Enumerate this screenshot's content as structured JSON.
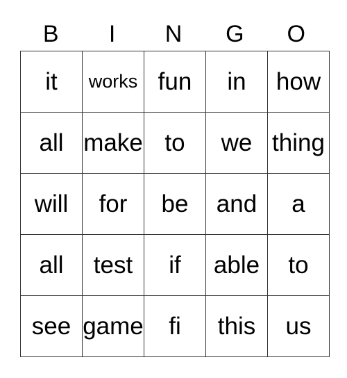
{
  "header": [
    "B",
    "I",
    "N",
    "G",
    "O"
  ],
  "rows": [
    [
      "it",
      "works",
      "fun",
      "in",
      "how"
    ],
    [
      "all",
      "make",
      "to",
      "we",
      "thing"
    ],
    [
      "will",
      "for",
      "be",
      "and",
      "a"
    ],
    [
      "all",
      "test",
      "if",
      "able",
      "to"
    ],
    [
      "see",
      "game",
      "fi",
      "this",
      "us"
    ]
  ]
}
